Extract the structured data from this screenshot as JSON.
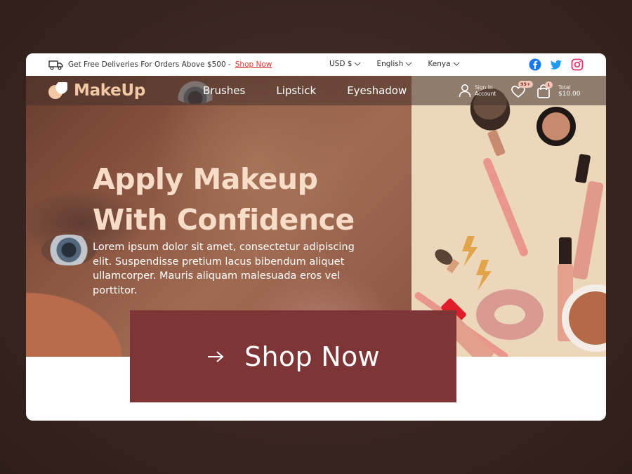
{
  "topbar": {
    "promo_text": "Get Free Deliveries For Orders Above $500 -",
    "promo_link": "Shop Now",
    "currency": "USD $",
    "language": "English",
    "country": "Kenya",
    "socials": [
      "facebook-icon",
      "twitter-icon",
      "instagram-icon"
    ]
  },
  "nav": {
    "logo": "MakeUp",
    "links": [
      "Brushes",
      "Lipstick",
      "Eyeshadow"
    ],
    "account_top": "Sign In",
    "account_bottom": "Account",
    "wishlist_badge": "95+",
    "cart_badge": "1",
    "total_label": "Total",
    "total_value": "$10.00"
  },
  "hero": {
    "headline_line1": "Apply Makeup",
    "headline_line2": "With Confidence",
    "subtext": "Lorem ipsum dolor sit amet, consectetur adipiscing elit. Suspendisse pretium lacus bibendum aliquet ullamcorper. Mauris aliquam malesuada eros vel porttitor.",
    "cta_label": "Shop Now"
  },
  "colors": {
    "accent": "#7d3536",
    "logo": "#f2c9a4",
    "headline": "#f7dcc8",
    "promo_link": "#e0392f",
    "facebook": "#1877f2",
    "twitter": "#1d9bf0",
    "instagram": "#e1306c"
  }
}
